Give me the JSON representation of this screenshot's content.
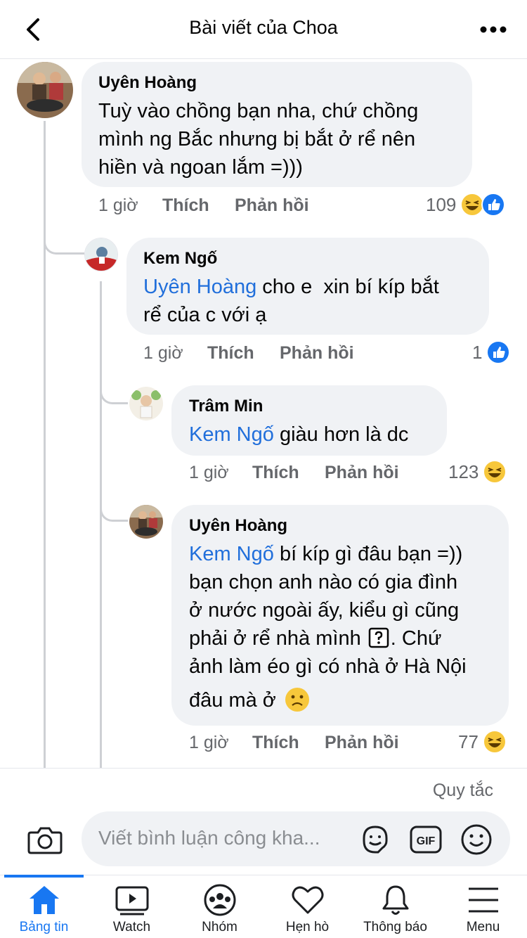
{
  "header": {
    "title": "Bài viết của Choa"
  },
  "comments": [
    {
      "author": "Uyên Hoàng",
      "lines": [
        "Tuỳ vào chồng bạn nha, chứ chồng",
        "mình ng Bắc nhưng bị bắt ở rể nên",
        "hiền và ngoan lắm =)))"
      ],
      "time": "1 giờ",
      "like": "Thích",
      "reply": "Phản hồi",
      "reaction_count": "109",
      "reactions": [
        "haha-icon",
        "like-icon"
      ]
    },
    {
      "author": "Kem Ngố",
      "mention": "Uyên Hoàng",
      "line1_rest": " cho e  xin bí kíp bắt",
      "line2": "rể của c với ạ",
      "time": "1 giờ",
      "like": "Thích",
      "reply": "Phản hồi",
      "reaction_count": "1",
      "reactions": [
        "like-icon"
      ]
    },
    {
      "author": "Trâm Min",
      "mention": "Kem Ngố",
      "line1_rest": " giàu hơn là dc",
      "time": "1 giờ",
      "like": "Thích",
      "reply": "Phản hồi",
      "reaction_count": "123",
      "reactions": [
        "haha-icon"
      ]
    },
    {
      "author": "Uyên Hoàng",
      "mention": "Kem Ngố",
      "line1_rest": " bí kíp gì đâu bạn =))",
      "lines": [
        "bạn chọn anh nào có gia đình",
        "ở nước ngoài ấy, kiểu gì cũng"
      ],
      "line4": "phải ở rể nhà mình",
      "line4_rest": ". Chứ",
      "line5": "ảnh làm éo gì có nhà ở Hà Nội",
      "line6": "đâu mà ở",
      "time": "1 giờ",
      "like": "Thích",
      "reply": "Phản hồi",
      "reaction_count": "77",
      "reactions": [
        "haha-icon"
      ]
    }
  ],
  "compose": {
    "rules": "Quy tắc",
    "placeholder": "Viết bình luận công kha..."
  },
  "tabs": [
    {
      "label": "Bảng tin",
      "icon": "home-icon",
      "active": true
    },
    {
      "label": "Watch",
      "icon": "watch-icon"
    },
    {
      "label": "Nhóm",
      "icon": "groups-icon"
    },
    {
      "label": "Hẹn hò",
      "icon": "heart-icon"
    },
    {
      "label": "Thông báo",
      "icon": "bell-icon"
    },
    {
      "label": "Menu",
      "icon": "menu-icon"
    }
  ],
  "colors": {
    "accent": "#1877f2",
    "mention": "#216fdb",
    "bubble": "#f0f2f5",
    "meta": "#65676b"
  }
}
